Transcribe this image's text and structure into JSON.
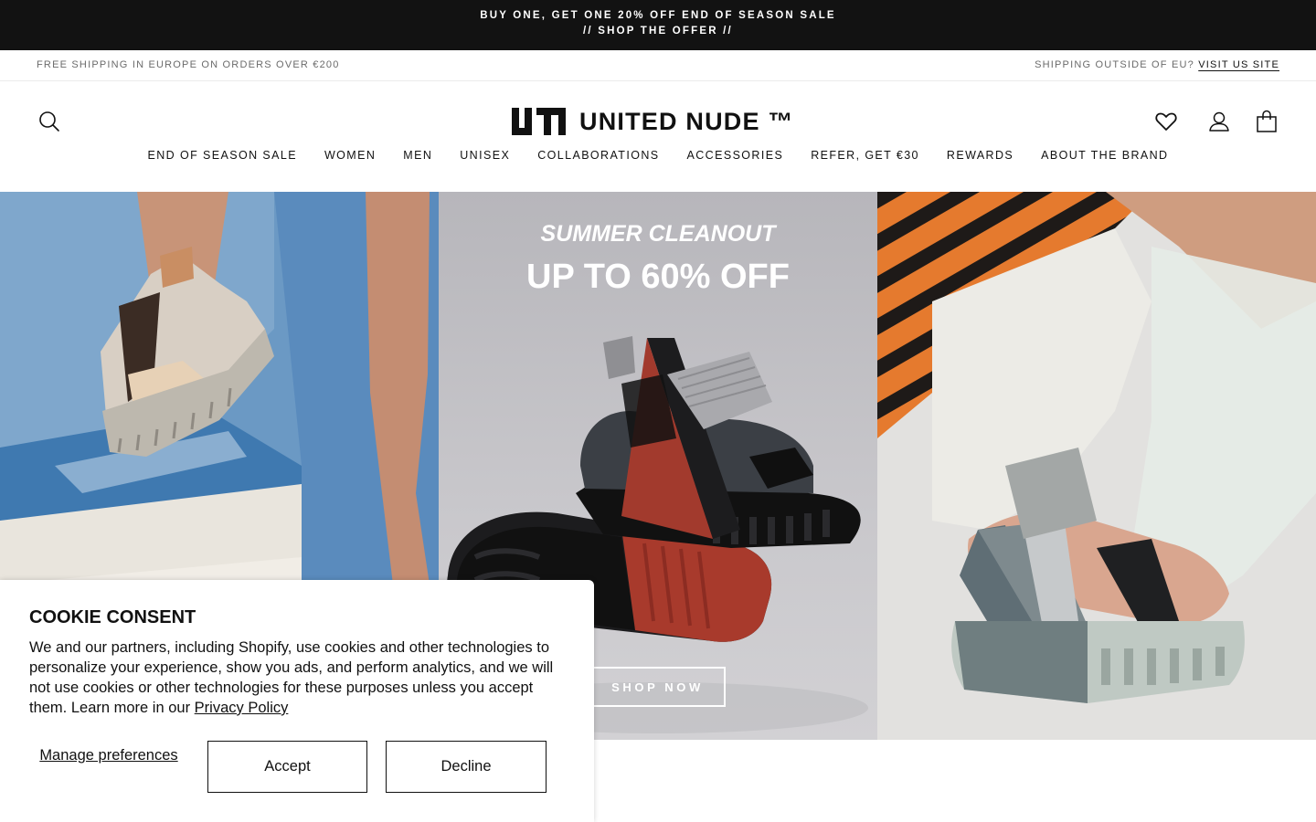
{
  "announcement": {
    "line1": "BUY ONE, GET ONE 20% OFF END OF SEASON SALE",
    "line2": "// SHOP THE OFFER //"
  },
  "utility": {
    "left_text": "FREE SHIPPING IN EUROPE ON ORDERS OVER €200",
    "right_text": "SHIPPING OUTSIDE OF EU?",
    "right_link": "VISIT US SITE"
  },
  "header": {
    "logo_text": "UNITED NUDE ™",
    "icons": [
      "search-icon",
      "heart-icon",
      "account-icon",
      "cart-icon"
    ]
  },
  "nav": {
    "items": [
      "END OF SEASON SALE",
      "WOMEN",
      "MEN",
      "UNISEX",
      "COLLABORATIONS",
      "ACCESSORIES",
      "REFER, GET €30",
      "REWARDS",
      "ABOUT THE BRAND"
    ]
  },
  "hero": {
    "subtitle": "SUMMER CLEANOUT",
    "title": "UP TO 60% OFF",
    "cta": "SHOP NOW"
  },
  "cookie": {
    "title": "COOKIE CONSENT",
    "body": "We and our partners, including Shopify, use cookies and other technologies to personalize your experience, show you ads, and perform analytics, and we will not use cookies or other technologies for these purposes unless you accept them. Learn more in our ",
    "privacy_link": "Privacy Policy",
    "manage_label": "Manage preferences",
    "accept_label": "Accept",
    "decline_label": "Decline"
  }
}
